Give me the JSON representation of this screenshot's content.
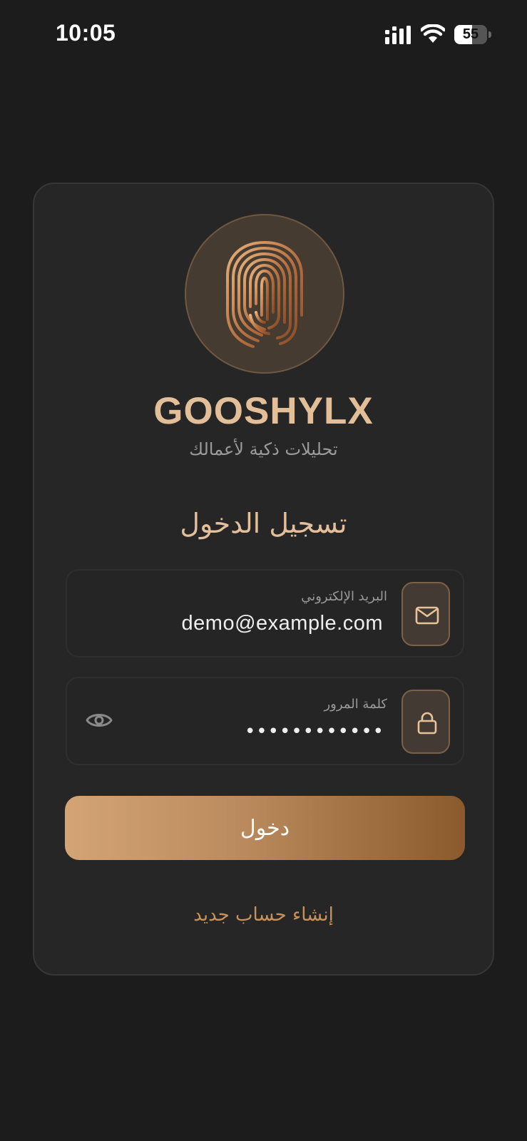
{
  "status_bar": {
    "time": "10:05",
    "battery_level": "55",
    "battery_fraction": 0.55,
    "icons": [
      "signal-icon",
      "wifi-icon",
      "battery-icon"
    ]
  },
  "brand": {
    "name": "GOOSHYLX",
    "tagline": "تحليلات ذكية لأعمالك",
    "logo_icon": "fingerprint-icon",
    "accent_color": "#d3a476"
  },
  "login": {
    "title": "تسجيل الدخول",
    "email": {
      "label": "البريد الإلكتروني",
      "value": "demo@example.com",
      "icon": "mail-icon"
    },
    "password": {
      "label": "كلمة المرور",
      "masked_value": "••••••••••••",
      "icon": "lock-icon",
      "toggle_icon": "eye-icon"
    },
    "submit_label": "دخول",
    "create_account_label": "إنشاء حساب جديد"
  }
}
